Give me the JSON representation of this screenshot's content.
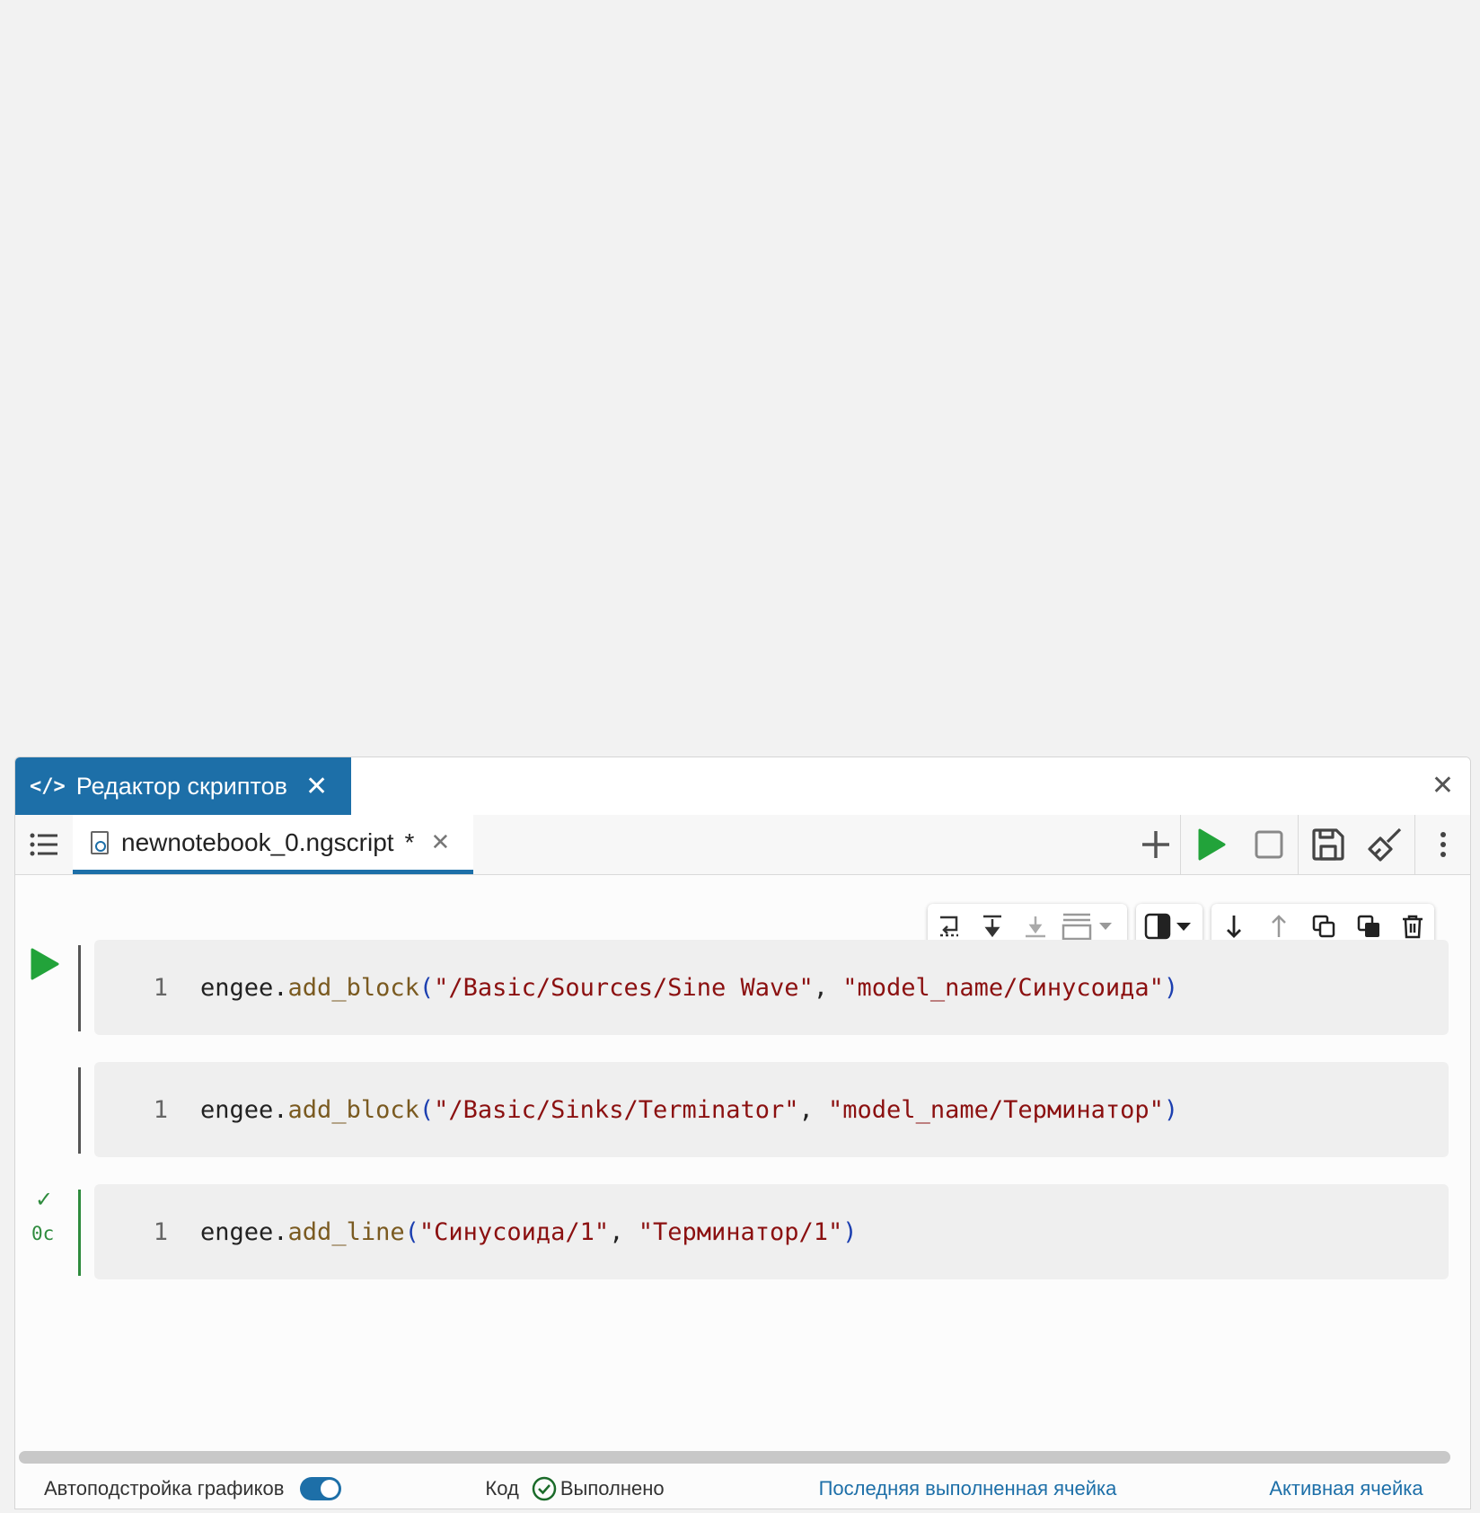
{
  "window_tab": {
    "icon": "code-icon",
    "label": "Редактор скриптов"
  },
  "file_tab": {
    "icon": "ngscript-file-icon",
    "name": "newnotebook_0.ngscript",
    "modified_marker": "*"
  },
  "toolbar": {
    "icons": [
      "plus-icon",
      "run-icon",
      "stop-icon",
      "save-icon",
      "clean-brush-icon",
      "more-vertical-icon"
    ],
    "run_color": "#22a33a"
  },
  "cell_toolbar": {
    "icons": [
      "run-and-next-icon",
      "run-above-icon",
      "run-below-icon",
      "cell-layout-dropdown-icon",
      "output-toggle-dropdown-icon",
      "move-down-icon",
      "move-up-icon",
      "duplicate-icon",
      "copy-icon",
      "delete-icon"
    ]
  },
  "cells": [
    {
      "line_number": "1",
      "tokens": [
        {
          "t": "engee.",
          "c": "plain"
        },
        {
          "t": "add_block",
          "c": "fn"
        },
        {
          "t": "(",
          "c": "paren"
        },
        {
          "t": "\"/Basic/Sources/Sine Wave\"",
          "c": "str"
        },
        {
          "t": ", ",
          "c": "plain"
        },
        {
          "t": "\"model_name/Синусоида\"",
          "c": "str"
        },
        {
          "t": ")",
          "c": "paren"
        }
      ]
    },
    {
      "line_number": "1",
      "tokens": [
        {
          "t": "engee.",
          "c": "plain"
        },
        {
          "t": "add_block",
          "c": "fn"
        },
        {
          "t": "(",
          "c": "paren"
        },
        {
          "t": "\"/Basic/Sinks/Terminator\"",
          "c": "str"
        },
        {
          "t": ", ",
          "c": "plain"
        },
        {
          "t": "\"model_name/Терминатор\"",
          "c": "str"
        },
        {
          "t": ")",
          "c": "paren"
        }
      ]
    },
    {
      "line_number": "1",
      "status_time": "0c",
      "tokens": [
        {
          "t": "engee.",
          "c": "plain"
        },
        {
          "t": "add_line",
          "c": "fn"
        },
        {
          "t": "(",
          "c": "paren"
        },
        {
          "t": "\"Синусоида/1\"",
          "c": "str"
        },
        {
          "t": ", ",
          "c": "plain"
        },
        {
          "t": "\"Терминатор/1\"",
          "c": "str"
        },
        {
          "t": ")",
          "c": "paren"
        }
      ]
    }
  ],
  "statusbar": {
    "autofit_label": "Автоподстройка графиков",
    "autofit_on": true,
    "mode_label": "Код",
    "exec_status": "Выполнено",
    "last_executed_link": "Последняя выполненная ячейка",
    "active_cell_link": "Активная ячейка"
  }
}
